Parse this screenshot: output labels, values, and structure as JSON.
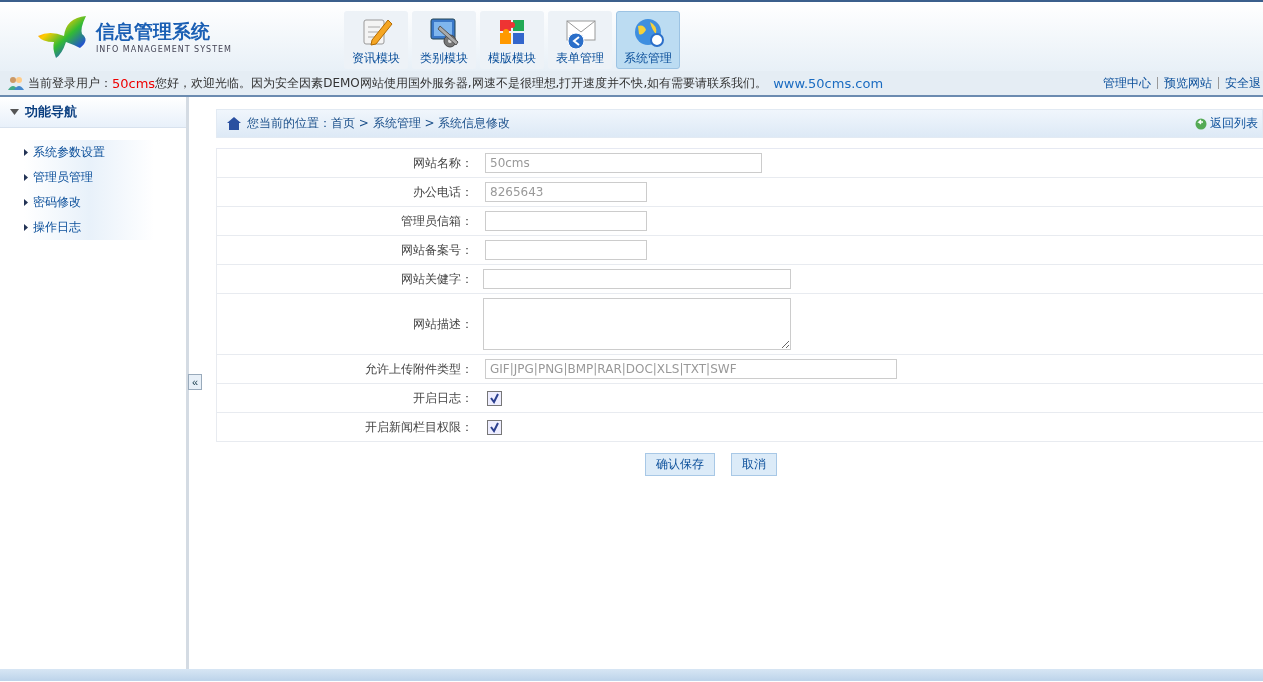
{
  "header": {
    "logo_title": "信息管理系统",
    "logo_subtitle": "INFO MANAGEMENT SYSTEM",
    "modules": [
      {
        "label": "资讯模块",
        "kind": "notepad",
        "selected": false
      },
      {
        "label": "类别模块",
        "kind": "tools",
        "selected": false
      },
      {
        "label": "模版模块",
        "kind": "puzzle",
        "selected": false
      },
      {
        "label": "表单管理",
        "kind": "mail",
        "selected": false
      },
      {
        "label": "系统管理",
        "kind": "globe",
        "selected": true
      }
    ]
  },
  "info_bar": {
    "prefix": "当前登录用户：",
    "username": "50cms",
    "message": "您好，欢迎光临。因为安全因素DEMO网站使用国外服务器,网速不是很理想,打开速度并不快,如有需要请联系我们。",
    "link": "www.50cms.com",
    "links": [
      "管理中心",
      "预览网站",
      "安全退"
    ]
  },
  "sidebar": {
    "title": "功能导航",
    "collapse": "«",
    "items": [
      "系统参数设置",
      "管理员管理",
      "密码修改",
      "操作日志"
    ]
  },
  "breadcrumb": {
    "text": "您当前的位置：首页 > 系统管理 > 系统信息修改",
    "back": "返回列表"
  },
  "form": {
    "rows": [
      {
        "label": "网站名称：",
        "kind": "text-long",
        "value": "50cms"
      },
      {
        "label": "办公电话：",
        "kind": "text-short",
        "value": "8265643"
      },
      {
        "label": "管理员信箱：",
        "kind": "text-short"
      },
      {
        "label": "网站备案号：",
        "kind": "text-short"
      },
      {
        "label": "网站关健字：",
        "kind": "text-wide"
      },
      {
        "label": "网站描述：",
        "kind": "textarea"
      },
      {
        "label": "允许上传附件类型：",
        "kind": "text-xwide",
        "value": "GIF|JPG|PNG|BMP|RAR|DOC|XLS|TXT|SWF"
      },
      {
        "label": "开启日志：",
        "kind": "checkbox",
        "checked": true
      },
      {
        "label": "开启新闻栏目权限：",
        "kind": "checkbox",
        "checked": true
      }
    ],
    "buttons": [
      "确认保存",
      "取消"
    ]
  }
}
